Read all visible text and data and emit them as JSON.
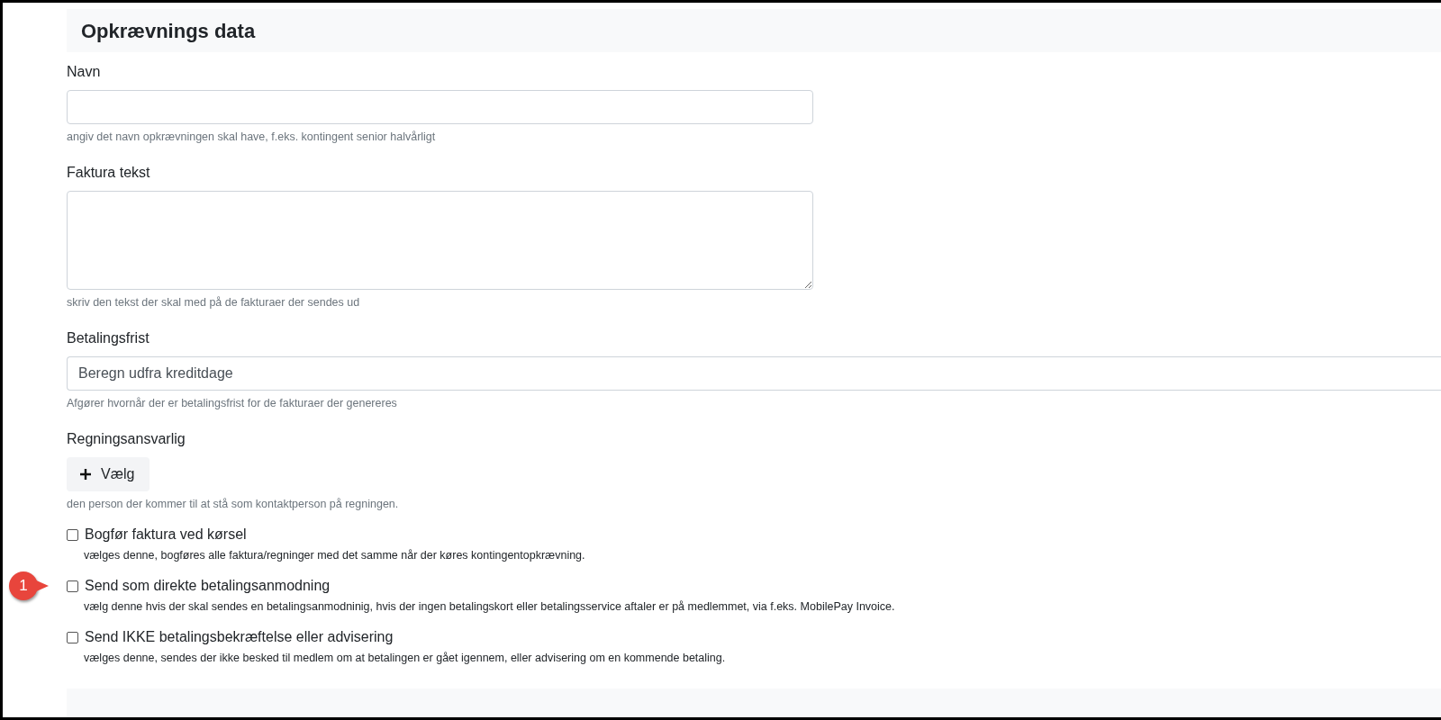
{
  "section": {
    "title": "Opkrævnings data"
  },
  "fields": [
    {
      "kind": "input",
      "label": "Navn",
      "hint": "angiv det navn opkrævningen skal have, f.eks. kontingent senior halvårligt"
    },
    {
      "kind": "textarea",
      "label": "Faktura tekst",
      "hint": "skriv den tekst der skal med på de fakturaer der sendes ud"
    },
    {
      "kind": "select",
      "label": "Betalingsfrist",
      "value": "Beregn udfra kreditdage",
      "hint": "Afgører hvornår der er betalingsfrist for de fakturaer der genereres"
    },
    {
      "kind": "button",
      "label": "Regningsansvarlig",
      "button": "Vælg",
      "hint": "den person der kommer til at stå som kontaktperson på regningen."
    }
  ],
  "checkboxes": [
    {
      "label": "Bogfør faktura ved kørsel",
      "checked": false,
      "hint": "vælges denne, bogføres alle faktura/regninger med det samme når der køres kontingentopkrævning."
    },
    {
      "label": "Send som direkte betalingsanmodning",
      "checked": false,
      "callout": "1",
      "hint": "vælg denne hvis der skal sendes en betalingsanmodninig, hvis der ingen betalingskort eller betalingsservice aftaler er på medlemmet, via f.eks. MobilePay Invoice."
    },
    {
      "label": "Send IKKE betalingsbekræftelse eller advisering",
      "checked": false,
      "hint": "vælges denne, sendes der ikke besked til medlem om at betalingen er gået igennem, eller advisering om en kommende betaling."
    }
  ]
}
